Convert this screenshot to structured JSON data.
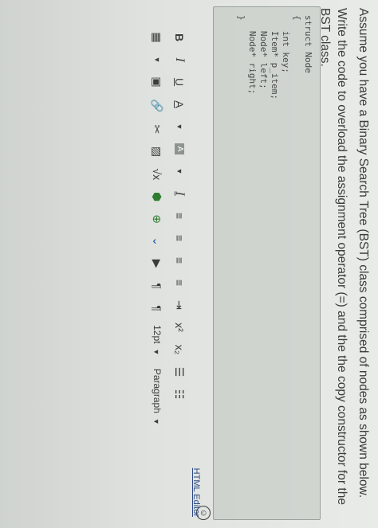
{
  "question": {
    "line1": "Assume you have a Binary Search Tree (BST) class comprised of nodes as shown below.",
    "line2": "Write the code to overload the assignment operator (=) and the the copy constructor for the BST class."
  },
  "code": {
    "lines": [
      "struct Node",
      "{",
      "   int key;",
      "   Item* p_item;",
      "   Node* left;",
      "   Node* right;",
      "}"
    ]
  },
  "editor": {
    "html_editor_label": "HTML Editor",
    "font_size": "12pt",
    "paragraph": "Paragraph",
    "toolbar_row1": [
      "B",
      "I",
      "U",
      "A",
      "A",
      "I",
      "x",
      "x"
    ],
    "superscript_label": "x²",
    "subscript_label": "x₂"
  }
}
